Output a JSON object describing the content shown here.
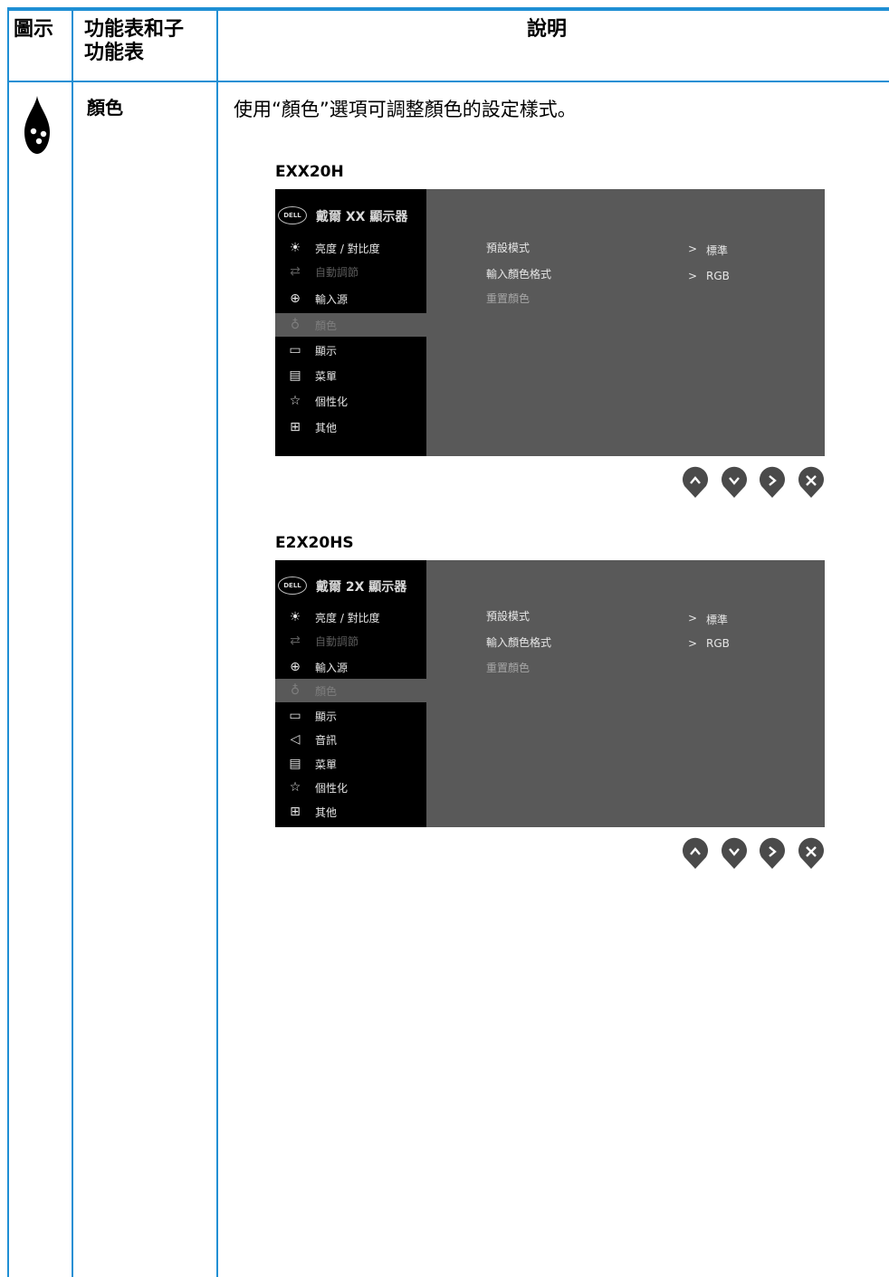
{
  "table": {
    "col_icon": "圖示",
    "col_menu": "功能表和子功能表",
    "col_desc": "說明",
    "row_menu": "顏色",
    "row_desc": "使用“顏色”選項可調整顏色的設定樣式。"
  },
  "osds": [
    {
      "model": "EXX20H",
      "logo": "DELL",
      "title": "戴爾 XX 顯示器",
      "menu": [
        "亮度 / 對比度",
        "自動調節",
        "輸入源",
        "顏色",
        "顯示",
        "菜單",
        "個性化",
        "其他"
      ],
      "submenu": [
        "預設模式",
        "輸入顏色格式",
        "重置顏色"
      ],
      "values": [
        "標準",
        "RGB"
      ]
    },
    {
      "model": "E2X20HS",
      "logo": "DELL",
      "title": "戴爾 2X 顯示器",
      "menu": [
        "亮度 / 對比度",
        "自動調節",
        "輸入源",
        "顏色",
        "顯示",
        "音訊",
        "菜單",
        "個性化",
        "其他"
      ],
      "submenu": [
        "預設模式",
        "輸入顏色格式",
        "重置顏色"
      ],
      "values": [
        "標準",
        "RGB"
      ]
    }
  ],
  "value_prefix": ">",
  "nav_icons": [
    "up-icon",
    "down-icon",
    "right-icon",
    "close-icon"
  ],
  "colors": {
    "table_border": "#1f8fd4",
    "osd_bg": "#595959",
    "osd_menu_bg": "#000000"
  }
}
